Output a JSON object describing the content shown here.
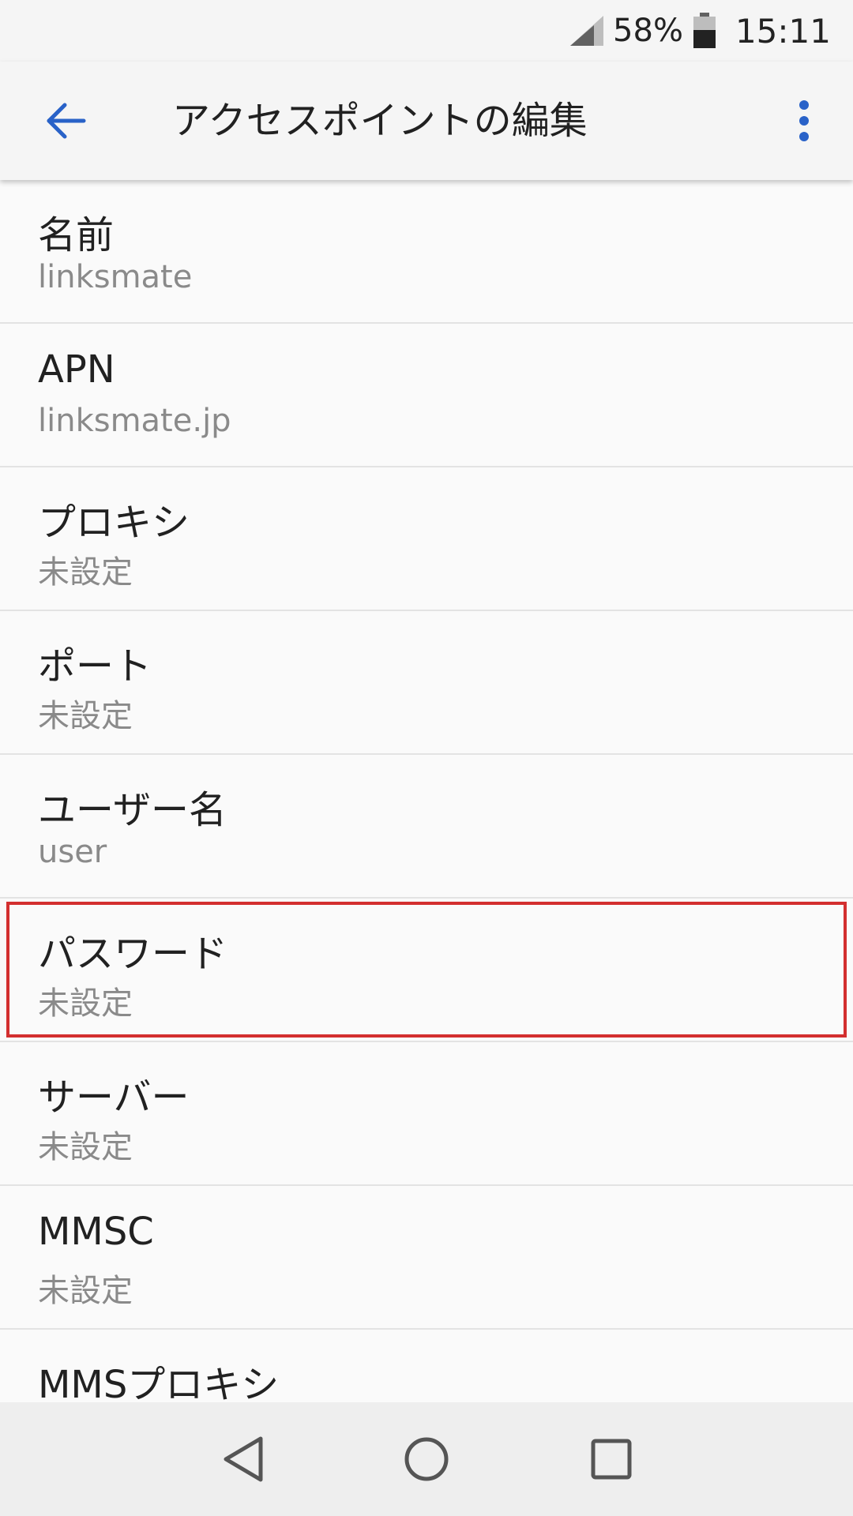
{
  "status_bar": {
    "battery_percent": "58%",
    "time": "15:11",
    "icons": [
      "signal-icon",
      "battery-icon"
    ]
  },
  "app_bar": {
    "title": "アクセスポイントの編集",
    "back_icon": "arrow-back-icon",
    "menu_icon": "more-vert-icon",
    "accent_color": "#2962c8"
  },
  "settings": [
    {
      "title": "名前",
      "value": "linksmate"
    },
    {
      "title": "APN",
      "value": "linksmate.jp"
    },
    {
      "title": "プロキシ",
      "value": "未設定"
    },
    {
      "title": "ポート",
      "value": "未設定"
    },
    {
      "title": "ユーザー名",
      "value": "user"
    },
    {
      "title": "パスワード",
      "value": "未設定"
    },
    {
      "title": "サーバー",
      "value": "未設定"
    },
    {
      "title": "MMSC",
      "value": "未設定"
    },
    {
      "title": "MMSプロキシ",
      "value": ""
    }
  ],
  "highlight": {
    "item": "パスワード",
    "color": "#d32f2f"
  },
  "nav_bar": {
    "icons": [
      "back-triangle-icon",
      "home-circle-icon",
      "recents-square-icon"
    ]
  }
}
